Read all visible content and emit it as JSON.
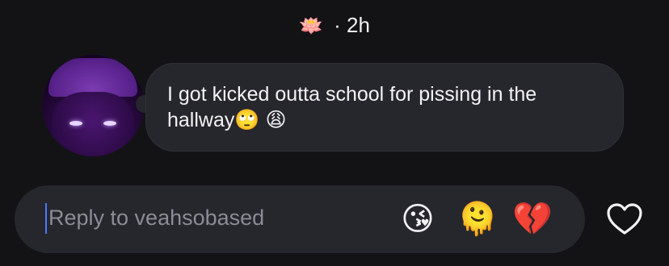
{
  "header": {
    "story_emoji": "🪷",
    "timestamp": "· 2h"
  },
  "message": {
    "text": "I got kicked outta school for pissing in the hallway🙄 😩"
  },
  "reply": {
    "placeholder": "Reply to veahsobased"
  },
  "quick_reactions": [
    "😘",
    "🫠",
    "💔"
  ],
  "icons": {
    "like": "heart-outline-icon"
  }
}
